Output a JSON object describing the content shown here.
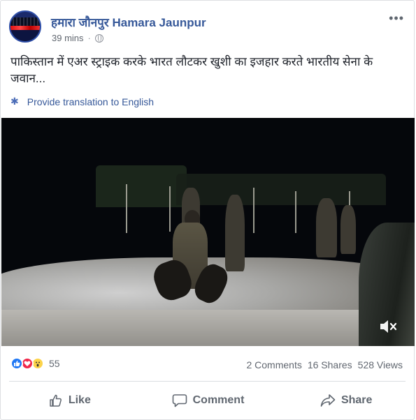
{
  "post": {
    "page_name": "हमारा जौनपुर Hamara Jaunpur",
    "time": "39 mins",
    "separator": "·",
    "more": "•••",
    "text": "पाकिस्तान में एअर स्ट्राइक करके भारत लौटकर खुशी का इजहार करते भारतीय सेना के जवान...",
    "translate_label": "Provide translation to English",
    "privacy_icon": "globe-icon",
    "settings_icon": "gear-icon"
  },
  "video": {
    "mute_icon": "speaker-muted-icon"
  },
  "engagement": {
    "reaction_icons": [
      "like-icon",
      "love-icon",
      "wow-icon"
    ],
    "reaction_count": "55",
    "comments": "2 Comments",
    "shares": "16 Shares",
    "views": "528 Views"
  },
  "actions": {
    "like_label": "Like",
    "comment_label": "Comment",
    "share_label": "Share"
  },
  "colors": {
    "link_blue": "#365899",
    "like_blue": "#2078f4",
    "love_red": "#f0284a",
    "wow_yellow": "#fcd34a",
    "muted_text": "#616770"
  }
}
